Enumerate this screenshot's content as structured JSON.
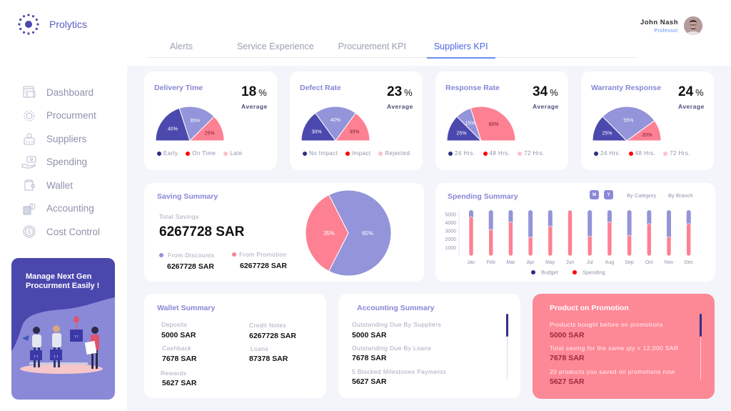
{
  "app": {
    "name": "Prolytics"
  },
  "user": {
    "name": "John Nash",
    "role": "Professor"
  },
  "sidebar": {
    "items": [
      {
        "label": "Dashboard",
        "icon": "dashboard-icon"
      },
      {
        "label": "Procurment",
        "icon": "gear-icon"
      },
      {
        "label": "Suppliers",
        "icon": "suppliers-icon"
      },
      {
        "label": "Spending",
        "icon": "hand-money-icon"
      },
      {
        "label": "Wallet",
        "icon": "wallet-icon"
      },
      {
        "label": "Accounting",
        "icon": "calculator-icon"
      },
      {
        "label": "Cost Control",
        "icon": "dollar-coin-icon"
      }
    ],
    "promo": {
      "title": "Manage Next Gen Procurment Easily !"
    }
  },
  "tabs": [
    {
      "label": "Alerts",
      "active": false
    },
    {
      "label": "Service Experience",
      "active": false
    },
    {
      "label": "Procurement KPI",
      "active": false
    },
    {
      "label": "Suppliers KPI",
      "active": true
    }
  ],
  "colors": {
    "dark": "#4b49ad",
    "mid": "#9394d9",
    "pink": "#fd8193",
    "legend_dark": "#2c2f7e",
    "legend_red": "#ff0000",
    "legend_light": "#ffc0cb"
  },
  "kpis": [
    {
      "title": "Delivery Time",
      "value": "18",
      "unit": "%",
      "avg_label": "Average",
      "segments": [
        {
          "label": "Early",
          "pct": 40
        },
        {
          "label": "On Time",
          "pct": 35
        },
        {
          "label": "Late",
          "pct": 25
        }
      ]
    },
    {
      "title": "Defect Rate",
      "value": "23",
      "unit": "%",
      "avg_label": "Average",
      "segments": [
        {
          "label": "No Impact",
          "pct": 30
        },
        {
          "label": "Impact",
          "pct": 40
        },
        {
          "label": "Rejected",
          "pct": 30
        }
      ]
    },
    {
      "title": "Response Rate",
      "value": "34",
      "unit": "%",
      "avg_label": "Average",
      "segments": [
        {
          "label": "24 Hrs.",
          "pct": 25
        },
        {
          "label": "48 Hrs.",
          "pct": 15
        },
        {
          "label": "72 Hrs.",
          "pct": 60
        }
      ]
    },
    {
      "title": "Warranty Response",
      "value": "24",
      "unit": "%",
      "avg_label": "Average",
      "segments": [
        {
          "label": "24 Hrs.",
          "pct": 25
        },
        {
          "label": "48 Hrs.",
          "pct": 55
        },
        {
          "label": "72 Hrs.",
          "pct": 20
        }
      ]
    }
  ],
  "saving": {
    "title": "Saving Summary",
    "total_label": "Total Savings",
    "total_value": "6267728 SAR",
    "discounts_label": "From Discounts",
    "discounts_value": "6267728 SAR",
    "promotion_label": "From Promotion",
    "promotion_value": "6267728 SAR"
  },
  "spending": {
    "title": "Spending Summary",
    "toggle_m": "M",
    "toggle_y": "Y",
    "filter_category": "By Category",
    "filter_branch": "By Branch"
  },
  "wallet": {
    "title": "Wallet Summary",
    "items": [
      {
        "label": "Deposits",
        "value": "5000 SAR"
      },
      {
        "label": "Credit Notes",
        "value": "6267728 SAR"
      },
      {
        "label": "Cashback",
        "value": "7678 SAR"
      },
      {
        "label": "Loans",
        "value": "87378 SAR"
      },
      {
        "label": "Rewards",
        "value": "5627 SAR"
      }
    ]
  },
  "accounting": {
    "title": "Accounting Summary",
    "items": [
      {
        "label": "Outstanding Due By Suppliers",
        "value": "5000 SAR"
      },
      {
        "label": "Outstanding Due By Loans",
        "value": "7678 SAR"
      },
      {
        "label": "5 Blocked Milestones Payments",
        "value": "5627 SAR"
      }
    ]
  },
  "promotion": {
    "title": "Product on Promotion",
    "items": [
      {
        "label": "Products bought before on promotions .",
        "value": "5000 SAR"
      },
      {
        "label": "Total saving for the same qty = 12,000 SAR",
        "value": "7678 SAR"
      },
      {
        "label": "20 products you saved on promotions now",
        "value": "5627 SAR"
      }
    ]
  },
  "chart_data": [
    {
      "type": "pie",
      "title": "Saving Summary",
      "categories": [
        "From Promotion",
        "From Discounts"
      ],
      "values": [
        35,
        65
      ],
      "labels": [
        "35%",
        "65%"
      ]
    },
    {
      "type": "bar",
      "title": "Spending Summary",
      "categories": [
        "Jan",
        "Feb",
        "Mar",
        "Apr",
        "May",
        "Jun",
        "Jul",
        "Aug",
        "Sep",
        "Oct",
        "Nov",
        "Dec"
      ],
      "series": [
        {
          "name": "Budget",
          "values": [
            5500,
            5500,
            5500,
            5500,
            5500,
            5500,
            5500,
            5500,
            5500,
            5500,
            5500,
            5500
          ]
        },
        {
          "name": "Spending",
          "values": [
            4700,
            3200,
            4100,
            2300,
            3600,
            5500,
            2400,
            4100,
            2500,
            3900,
            2300,
            3900
          ]
        }
      ],
      "yticks": [
        1000,
        2000,
        3000,
        4000,
        5000
      ],
      "ylim": [
        0,
        5500
      ],
      "legend": "bottom",
      "grid": false
    }
  ]
}
